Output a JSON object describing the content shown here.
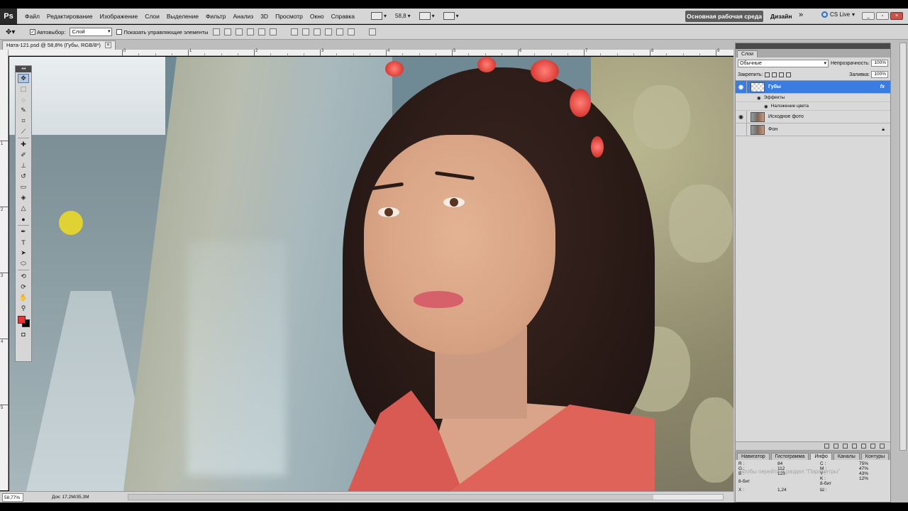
{
  "menu": [
    "Файл",
    "Редактирование",
    "Изображение",
    "Слои",
    "Выделение",
    "Фильтр",
    "Анализ",
    "3D",
    "Просмотр",
    "Окно",
    "Справка"
  ],
  "app_logo": "Ps",
  "zoom_widget": "58,8",
  "workspace": {
    "active": "Основная рабочая среда",
    "other": "Дизайн",
    "more": "»"
  },
  "cs_live": "CS Live",
  "options": {
    "autoselect_label": "Автовыбор:",
    "autoselect_value": "Слой",
    "show_controls_label": "Показать управляющие элементы"
  },
  "document": {
    "tab_title": "Ната-121.psd @ 58,8% (Губы, RGB/8*)"
  },
  "ruler_h": [
    "0",
    "1",
    "2",
    "3",
    "4",
    "5",
    "6",
    "7",
    "8",
    "9",
    "10"
  ],
  "ruler_v": [
    "1",
    "2",
    "3",
    "4",
    "5"
  ],
  "statusbar": {
    "zoom": "58,77%",
    "doc": "Док: 17,2M/35,3M"
  },
  "layers_panel": {
    "tab": "Слои",
    "blend_mode": "Обычные",
    "opacity_label": "Непрозрачность:",
    "opacity_value": "100%",
    "lock_label": "Закрепить:",
    "fill_label": "Заливка:",
    "fill_value": "100%",
    "layers": [
      {
        "name": "Губы",
        "effects_label": "Эффекты",
        "effect": "Наложение цвета"
      },
      {
        "name": "Исходное фото"
      },
      {
        "name": "Фон"
      }
    ]
  },
  "info_panel": {
    "tabs": [
      "Навигатор",
      "Гистограмма",
      "Инфо",
      "Каналы",
      "Контуры"
    ],
    "rgb": [
      "R :",
      "G :",
      "B :"
    ],
    "rgb_values": [
      "84",
      "112",
      "123"
    ],
    "cmyk": [
      "C :",
      "M :",
      "Y :",
      "K :"
    ],
    "cmyk_values": [
      "75%",
      "47%",
      "43%",
      "12%"
    ],
    "bit_left": "8-бит",
    "bit_right": "8-бит",
    "x_label": "X :",
    "x_value": "1,24",
    "w_label": "Ш :",
    "watermark": "Чтобы перейти в раздел \"Параметры\""
  }
}
